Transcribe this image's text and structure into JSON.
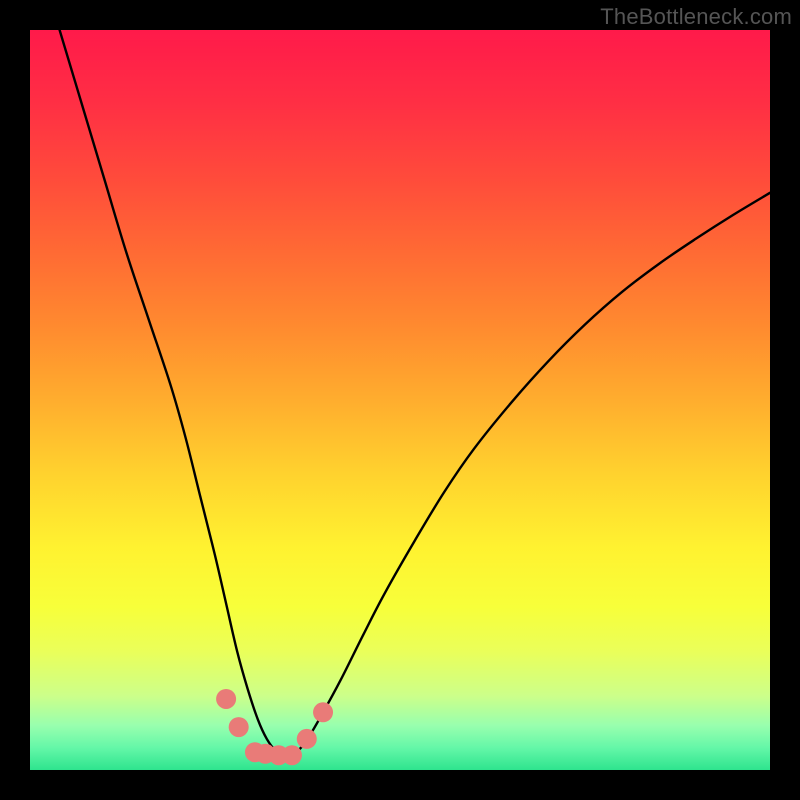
{
  "watermark": "TheBottleneck.com",
  "gradient": {
    "stops": [
      {
        "offset": 0.0,
        "color": "#ff1a4a"
      },
      {
        "offset": 0.1,
        "color": "#ff2f44"
      },
      {
        "offset": 0.2,
        "color": "#ff4b3b"
      },
      {
        "offset": 0.3,
        "color": "#ff6a34"
      },
      {
        "offset": 0.4,
        "color": "#ff8a2f"
      },
      {
        "offset": 0.5,
        "color": "#ffad2e"
      },
      {
        "offset": 0.6,
        "color": "#ffd22e"
      },
      {
        "offset": 0.7,
        "color": "#fff230"
      },
      {
        "offset": 0.78,
        "color": "#f7ff3a"
      },
      {
        "offset": 0.84,
        "color": "#eaff5a"
      },
      {
        "offset": 0.9,
        "color": "#ccff8a"
      },
      {
        "offset": 0.94,
        "color": "#98ffae"
      },
      {
        "offset": 0.97,
        "color": "#64f7a8"
      },
      {
        "offset": 1.0,
        "color": "#2ee48e"
      }
    ]
  },
  "chart_data": {
    "type": "line",
    "title": "",
    "xlabel": "",
    "ylabel": "",
    "xlim": [
      0,
      100
    ],
    "ylim": [
      0,
      100
    ],
    "series": [
      {
        "name": "curve",
        "x": [
          4,
          7,
          10,
          13,
          16,
          19,
          21,
          23,
          25,
          26.5,
          28,
          29.4,
          30.8,
          32,
          33.2,
          34.5,
          36,
          37.5,
          39.5,
          42,
          45,
          48,
          52,
          56,
          60,
          65,
          70,
          75,
          80,
          85,
          90,
          95,
          100
        ],
        "y": [
          100,
          90,
          80,
          70,
          61,
          52,
          45,
          37,
          29,
          22.5,
          16,
          11,
          6.8,
          4.2,
          2.6,
          1.8,
          2.4,
          4.2,
          7.6,
          12.2,
          18.2,
          24,
          31,
          37.6,
          43.4,
          49.6,
          55.2,
          60.2,
          64.6,
          68.4,
          71.8,
          75.0,
          78.0
        ]
      },
      {
        "name": "markers",
        "type": "scatter",
        "color": "#e97b78",
        "x": [
          26.5,
          28.2,
          30.4,
          31.8,
          33.6,
          35.4,
          37.4,
          39.6
        ],
        "y": [
          9.6,
          5.8,
          2.4,
          2.2,
          2.0,
          2.0,
          4.2,
          7.8
        ]
      }
    ]
  }
}
